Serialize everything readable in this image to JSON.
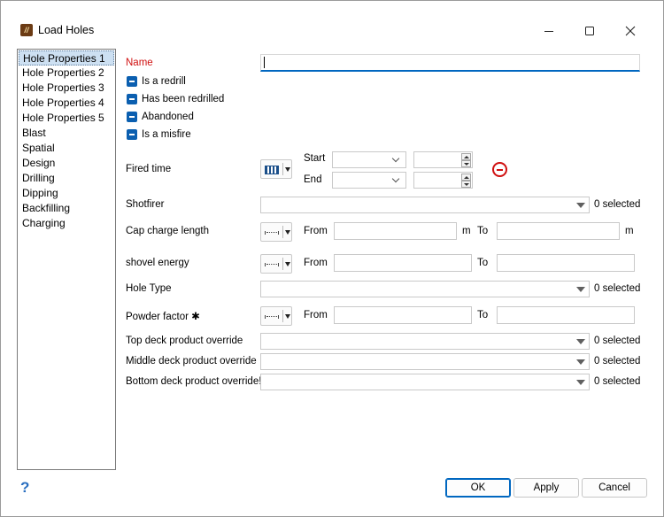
{
  "window": {
    "title": "Load Holes",
    "app_icon_glyph": "//"
  },
  "nav": {
    "items": [
      {
        "label": "Hole Properties 1",
        "selected": true
      },
      {
        "label": "Hole Properties 2"
      },
      {
        "label": "Hole Properties 3"
      },
      {
        "label": "Hole Properties 4"
      },
      {
        "label": "Hole Properties 5"
      },
      {
        "label": "Blast"
      },
      {
        "label": "Spatial"
      },
      {
        "label": "Design"
      },
      {
        "label": "Drilling"
      },
      {
        "label": "Dipping"
      },
      {
        "label": "Backfilling"
      },
      {
        "label": "Charging"
      }
    ]
  },
  "form": {
    "name_label": "Name",
    "name_value": "",
    "checkboxes": [
      {
        "label": "Is a redrill"
      },
      {
        "label": "Has been redrilled"
      },
      {
        "label": "Abandoned"
      },
      {
        "label": "Is a misfire"
      }
    ],
    "fired_time": {
      "label": "Fired time",
      "start_label": "Start",
      "end_label": "End"
    },
    "shotfirer": {
      "label": "Shotfirer",
      "selected": "0 selected"
    },
    "cap_charge_length": {
      "label": "Cap charge length",
      "from_label": "From",
      "to_label": "To",
      "unit": "m"
    },
    "shovel_energy": {
      "label": "shovel energy",
      "from_label": "From",
      "to_label": "To"
    },
    "hole_type": {
      "label": "Hole Type",
      "selected": "0 selected"
    },
    "powder_factor": {
      "label": "Powder factor ✱",
      "from_label": "From",
      "to_label": "To"
    },
    "top_deck": {
      "label": "Top deck product override",
      "selected": "0 selected"
    },
    "middle_deck": {
      "label": "Middle deck product override",
      "selected": "0 selected"
    },
    "bottom_deck": {
      "label": "Bottom deck product override!",
      "selected": "0 selected"
    }
  },
  "footer": {
    "help_glyph": "?",
    "ok_label": "OK",
    "apply_label": "Apply",
    "cancel_label": "Cancel"
  },
  "colors": {
    "accent": "#0067c0",
    "error_red": "#d01010",
    "selection": "#cde0f2"
  }
}
